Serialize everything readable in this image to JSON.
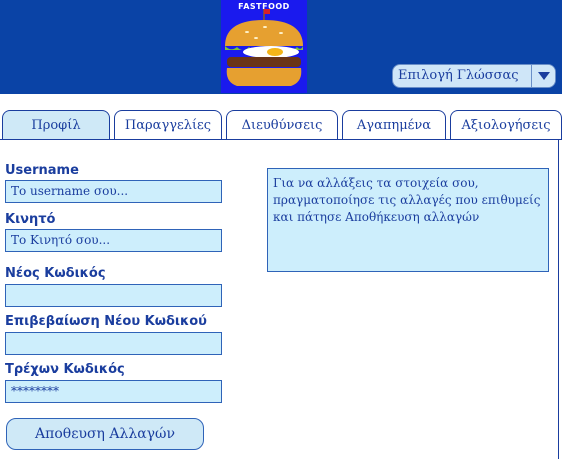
{
  "header": {
    "logo_text": "FASTFOOD",
    "language_select": {
      "selected": "Επιλογή Γλώσσας"
    }
  },
  "tabs": [
    {
      "label": "Προφίλ",
      "active": true
    },
    {
      "label": "Παραγγελίες",
      "active": false
    },
    {
      "label": "Διευθύνσεις",
      "active": false
    },
    {
      "label": "Αγαπημένα",
      "active": false
    },
    {
      "label": "Αξιολογήσεις",
      "active": false
    }
  ],
  "form": {
    "username": {
      "label": "Username",
      "placeholder": "Το username σου...",
      "value": ""
    },
    "phone": {
      "label": "Κινητό",
      "placeholder": "Το Κινητό σου...",
      "value": ""
    },
    "new_password": {
      "label": "Νέος Κωδικός",
      "value": ""
    },
    "confirm_password": {
      "label": "Επιβεβαίωση Νέου Κωδικού",
      "value": ""
    },
    "current_password": {
      "label": "Τρέχων Κωδικός",
      "value": "********"
    }
  },
  "info_text": "Για να αλλάξεις τα στοιχεία σου, πραγματοποίησε τις αλλαγές που επιθυμείς και πάτησε Αποθήκευση αλλαγών",
  "save_button_label": "Αποθευση Αλλαγών",
  "colors": {
    "header_bg": "#0a43a6",
    "accent": "#1a3d9e",
    "field_bg": "#cdeefc",
    "tab_active_bg": "#cfe9f7"
  },
  "icons": {
    "logo": "burger-logo",
    "dropdown": "chevron-down-icon"
  }
}
